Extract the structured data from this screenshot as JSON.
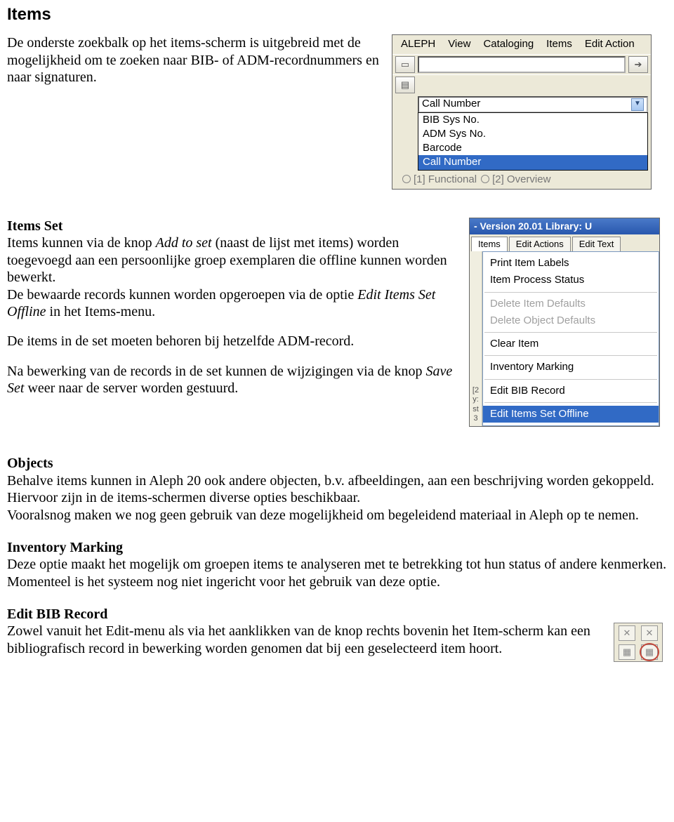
{
  "doc": {
    "h1": "Items",
    "intro": "De onderste zoekbalk op het items-scherm is uitgebreid met de mogelijkheid om te zoeken naar BIB- of ADM-recordnummers en naar signaturen.",
    "itemsSet": {
      "head": "Items Set",
      "p1a": "Items kunnen via de knop ",
      "p1i": "Add to set",
      "p1b": " (naast de lijst met items) worden toegevoegd aan een persoonlijke groep exemplaren die offline kunnen worden bewerkt.",
      "p2a": "De bewaarde records kunnen worden opgeroepen via de optie ",
      "p2i": "Edit Items Set Offline",
      "p2b": " in het Items-menu.",
      "p3": "De items in de set moeten behoren bij hetzelfde ADM-record.",
      "p4a": "Na bewerking van de records in de set kunnen de wijzigingen via de knop ",
      "p4i": "Save Set",
      "p4b": " weer naar de server worden gestuurd."
    },
    "objects": {
      "head": "Objects",
      "p1": "Behalve items kunnen in Aleph 20 ook andere objecten, b.v. afbeeldingen, aan een beschrijving worden gekoppeld. Hiervoor zijn in de items-schermen diverse opties beschikbaar.",
      "p2": "Vooralsnog maken we nog geen gebruik van deze mogelijkheid om begeleidend materiaal in Aleph op te nemen."
    },
    "inv": {
      "head": "Inventory Marking",
      "p1": "Deze optie maakt het mogelijk om groepen items te analyseren met te betrekking tot hun status of andere kenmerken.",
      "p2": "Momenteel is het systeem nog niet ingericht voor het gebruik van deze optie."
    },
    "editbib": {
      "head": "Edit BIB Record",
      "p": "Zowel vanuit het Edit-menu als via het aanklikken van de knop rechts bovenin het Item-scherm kan een bibliografisch record in bewerking worden genomen dat bij een geselecteerd item hoort."
    }
  },
  "shot1": {
    "menu": [
      "ALEPH",
      "View",
      "Cataloging",
      "Items",
      "Edit Action"
    ],
    "comboValue": "Call Number",
    "options": [
      "BIB Sys No.",
      "ADM Sys No.",
      "Barcode",
      "Call Number"
    ],
    "selectedIndex": 3,
    "tabs": [
      "[1] Functional",
      "[2] Overview"
    ]
  },
  "shot2": {
    "title": "- Version 20.01 Library: U",
    "tabs": [
      "Items",
      "Edit Actions",
      "Edit Text"
    ],
    "menuItems": [
      {
        "label": "Print Item Labels",
        "state": "mi"
      },
      {
        "label": "Item Process Status",
        "state": "mi"
      },
      {
        "label": "",
        "state": "sep"
      },
      {
        "label": "Delete Item Defaults",
        "state": "dis"
      },
      {
        "label": "Delete Object Defaults",
        "state": "dis"
      },
      {
        "label": "",
        "state": "sep"
      },
      {
        "label": "Clear Item",
        "state": "mi"
      },
      {
        "label": "",
        "state": "sep"
      },
      {
        "label": "Inventory Marking",
        "state": "mi"
      },
      {
        "label": "",
        "state": "sep"
      },
      {
        "label": "Edit BIB Record",
        "state": "mi"
      },
      {
        "label": "",
        "state": "sep"
      },
      {
        "label": "Edit Items Set Offline",
        "state": "hl"
      }
    ],
    "gutter": [
      "[2",
      "y:",
      "st",
      "3"
    ]
  }
}
